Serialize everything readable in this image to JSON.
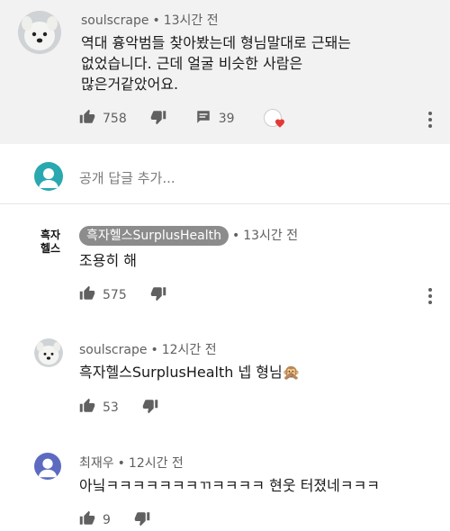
{
  "top_comment": {
    "author": "soulscrape",
    "time": "13시간 전",
    "lines": [
      "역대 흉악범들 찾아봤는데 형님말대로 근돼는",
      "없었습니다. 근데 얼굴 비슷한 사람은",
      "많은거같았어요."
    ],
    "likes": "758",
    "replies_count": "39",
    "icons": [
      "thumb-up-icon",
      "thumb-down-icon",
      "comment-icon",
      "creator-heart-icon",
      "more-vert-icon"
    ]
  },
  "reply_box": {
    "placeholder": "공개 답글 추가..."
  },
  "replies": [
    {
      "author": "흑자헬스SurplusHealth",
      "time": "13시간 전",
      "text": "조용히 해",
      "likes": "575",
      "avatar_text": "흑자\n헬스"
    },
    {
      "author": "soulscrape",
      "time": "12시간 전",
      "text": "흑자헬스SurplusHealth 넵 형님🙊",
      "likes": "53"
    },
    {
      "author": "최재우",
      "time": "12시간 전",
      "text": "아닠ㅋㅋㅋㅋㅋㅋㅋㄲㅋㅋㅋㅋ 현웃 터졌네ㅋㅋㅋ",
      "likes": "9"
    }
  ],
  "colors": {
    "background": "#ffffff",
    "highlight": "#f2f2f2",
    "meta_text": "#606060",
    "chip": "#8c8c8c",
    "heart": "#e53935"
  }
}
